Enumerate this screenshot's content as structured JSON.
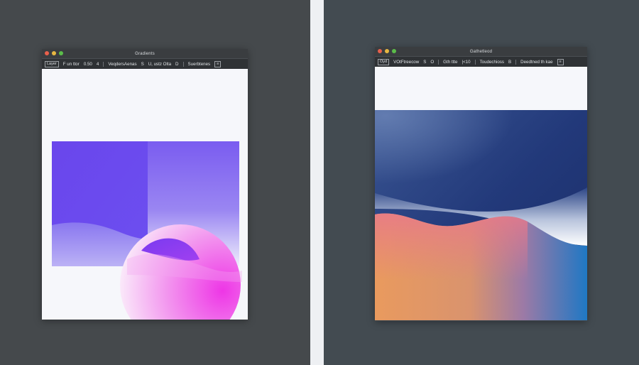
{
  "left_window": {
    "title": "Gradients",
    "toolbar": {
      "item1": "Layer",
      "item2": "F un ttor",
      "item3": "0.50",
      "item4": "4",
      "item5": "VeqdersAenas",
      "item6": "S",
      "item7": "U, ustz Olta",
      "item8": "D",
      "item9": "Suerbtenes",
      "item10": "≡"
    }
  },
  "right_window": {
    "title": "Gathetleod",
    "toolbar": {
      "item1": "Oyd",
      "item2": "VOtFtreecow",
      "item3": "S",
      "item4": "O",
      "item5": "Gth ttte",
      "item6": "|<10",
      "item7": "Toudechioss",
      "item8": "B",
      "item9": "Deedtned th kae",
      "item10": "≡"
    }
  },
  "colors": {
    "desktop_left": "#45494c",
    "desktop_right": "#434b51",
    "divider": "#eef0f3",
    "violet": "#6a45ef",
    "magenta": "#ef3be0",
    "navy": "#1e326d",
    "peach": "#e99a5e",
    "blue": "#1f78c4"
  }
}
